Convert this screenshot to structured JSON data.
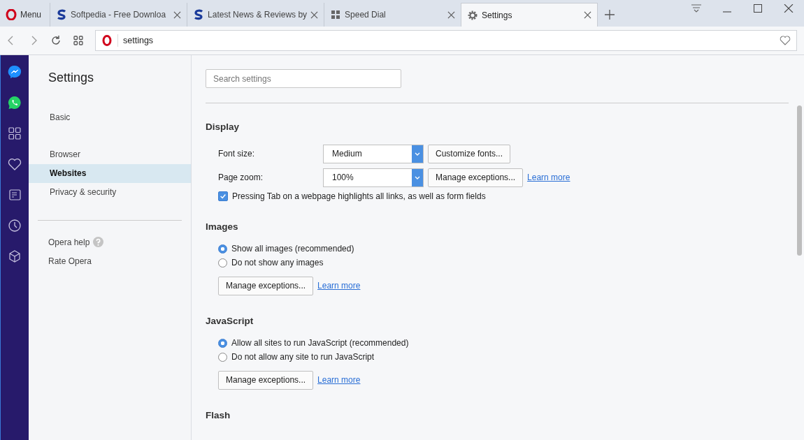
{
  "menu": {
    "label": "Menu"
  },
  "tabs": [
    {
      "title": "Softpedia - Free Downloa",
      "selected": false
    },
    {
      "title": "Latest News & Reviews by",
      "selected": false
    },
    {
      "title": "Speed Dial",
      "selected": false
    },
    {
      "title": "Settings",
      "selected": true
    }
  ],
  "address": {
    "value": "settings"
  },
  "nav": {
    "title": "Settings",
    "groups": [
      [
        {
          "label": "Basic",
          "selected": false
        }
      ],
      [
        {
          "label": "Browser",
          "selected": false
        },
        {
          "label": "Websites",
          "selected": true
        },
        {
          "label": "Privacy & security",
          "selected": false
        }
      ]
    ],
    "links": [
      {
        "label": "Opera help",
        "help": true
      },
      {
        "label": "Rate Opera",
        "help": false
      }
    ]
  },
  "search": {
    "placeholder": "Search settings"
  },
  "sections": [
    {
      "title": "Display",
      "rows": [
        {
          "kind": "select",
          "label": "Font size:",
          "value": "Medium",
          "button": "Customize fonts..."
        },
        {
          "kind": "select",
          "label": "Page zoom:",
          "value": "100%",
          "button": "Manage exceptions...",
          "link": "Learn more"
        },
        {
          "kind": "checkbox",
          "label": "Pressing Tab on a webpage highlights all links, as well as form fields",
          "checked": true
        }
      ]
    },
    {
      "title": "Images",
      "rows": [
        {
          "kind": "radio",
          "label": "Show all images (recommended)",
          "selected": true
        },
        {
          "kind": "radio",
          "label": "Do not show any images",
          "selected": false
        },
        {
          "kind": "actions",
          "button": "Manage exceptions...",
          "link": "Learn more"
        }
      ]
    },
    {
      "title": "JavaScript",
      "rows": [
        {
          "kind": "radio",
          "label": "Allow all sites to run JavaScript (recommended)",
          "selected": true
        },
        {
          "kind": "radio",
          "label": "Do not allow any site to run JavaScript",
          "selected": false
        },
        {
          "kind": "actions",
          "button": "Manage exceptions...",
          "link": "Learn more"
        }
      ]
    },
    {
      "title": "Flash"
    }
  ]
}
